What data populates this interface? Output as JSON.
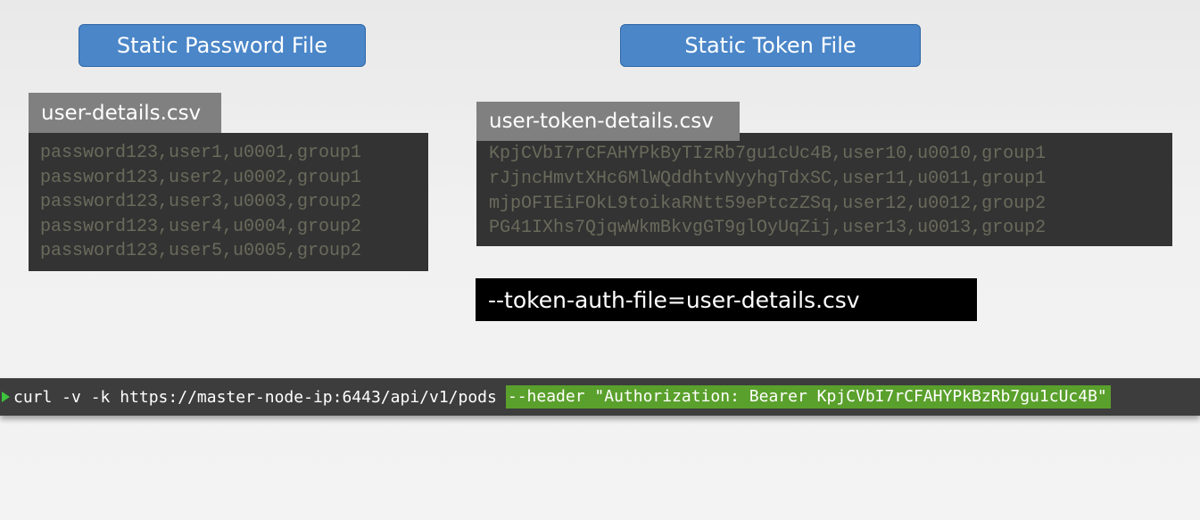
{
  "buttons": {
    "password": "Static Password File",
    "token": "Static Token File"
  },
  "password_file": {
    "name": "user-details.csv",
    "lines": [
      "password123,user1,u0001,group1",
      "password123,user2,u0002,group1",
      "password123,user3,u0003,group2",
      "password123,user4,u0004,group2",
      "password123,user5,u0005,group2"
    ]
  },
  "token_file": {
    "name": "user-token-details.csv",
    "lines": [
      "KpjCVbI7rCFAHYPkByTIzRb7gu1cUc4B,user10,u0010,group1",
      "rJjncHmvtXHc6MlWQddhtvNyyhgTdxSC,user11,u0011,group1",
      "mjpOFIEiFOkL9toikaRNtt59ePtczZSq,user12,u0012,group2",
      "PG41IXhs7QjqwWkmBkvgGT9glOyUqZij,user13,u0013,group2"
    ]
  },
  "auth_flag": "--token-auth-file=user-details.csv",
  "terminal": {
    "command": "curl -v -k https://master-node-ip:6443/api/v1/pods",
    "header_arg": "--header \"Authorization: Bearer KpjCVbI7rCFAHYPkBzRb7gu1cUc4B\""
  },
  "colors": {
    "pill_blue": "#4a86c8",
    "label_gray": "#808080",
    "code_bg": "#333333",
    "highlight_green": "#5aa02c",
    "prompt_green": "#3dc43d"
  }
}
